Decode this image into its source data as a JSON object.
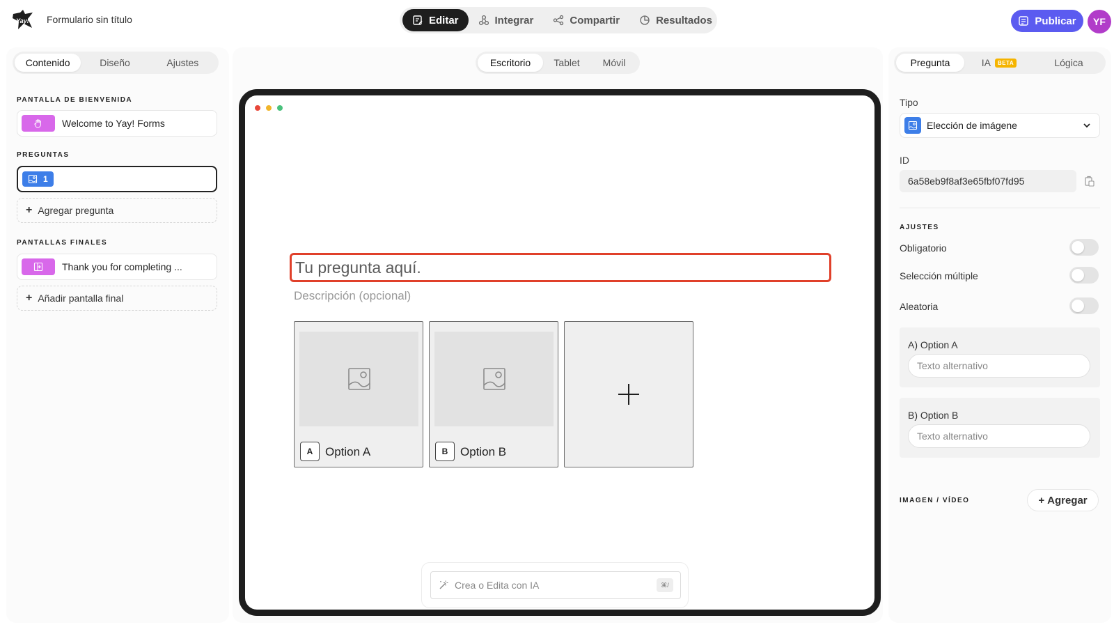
{
  "header": {
    "doc_title": "Formulario sin título",
    "nav": [
      {
        "label": "Editar",
        "icon": "edit-icon"
      },
      {
        "label": "Integrar",
        "icon": "integrate-icon"
      },
      {
        "label": "Compartir",
        "icon": "share-icon"
      },
      {
        "label": "Resultados",
        "icon": "results-icon"
      }
    ],
    "publish_label": "Publicar",
    "avatar_initials": "YF"
  },
  "left": {
    "tabs": [
      "Contenido",
      "Diseño",
      "Ajustes"
    ],
    "welcome_title": "PANTALLA DE BIENVENIDA",
    "welcome_item": "Welcome to Yay! Forms",
    "questions_title": "PREGUNTAS",
    "question_number": "1",
    "add_question": "Agregar pregunta",
    "endings_title": "PANTALLAS FINALES",
    "ending_item": "Thank you for completing ...",
    "add_ending": "Añadir pantalla final"
  },
  "center": {
    "devices": [
      "Escritorio",
      "Tablet",
      "Móvil"
    ],
    "question_placeholder": "Tu pregunta aquí.",
    "description_placeholder": "Descripción (opcional)",
    "options": [
      {
        "key": "A",
        "label": "Option A"
      },
      {
        "key": "B",
        "label": "Option B"
      }
    ],
    "ai_placeholder": "Crea o Edita con IA",
    "ai_shortcut": "⌘/"
  },
  "right": {
    "tabs": [
      "Pregunta",
      "IA",
      "Lógica"
    ],
    "beta_badge": "BETA",
    "type_label": "Tipo",
    "type_value": "Elección de imágene",
    "id_label": "ID",
    "id_value": "6a58eb9f8af3e65fbf07fd95",
    "settings_title": "AJUSTES",
    "toggles": [
      {
        "label": "Obligatorio",
        "on": false
      },
      {
        "label": "Selección múltiple",
        "on": false
      },
      {
        "label": "Aleatoria",
        "on": false
      }
    ],
    "option_alts": [
      {
        "label": "A) Option A",
        "placeholder": "Texto alternativo"
      },
      {
        "label": "B) Option B",
        "placeholder": "Texto alternativo"
      }
    ],
    "media_title": "IMAGEN / VÍDEO",
    "add_media": "Agregar"
  },
  "colors": {
    "accent": "#5b5bf0",
    "avatar": "#b13cc9",
    "question_chip": "#3d7ee8",
    "screen_chip": "#d868ea",
    "highlight": "#e0402a",
    "beta": "#f5b400"
  }
}
